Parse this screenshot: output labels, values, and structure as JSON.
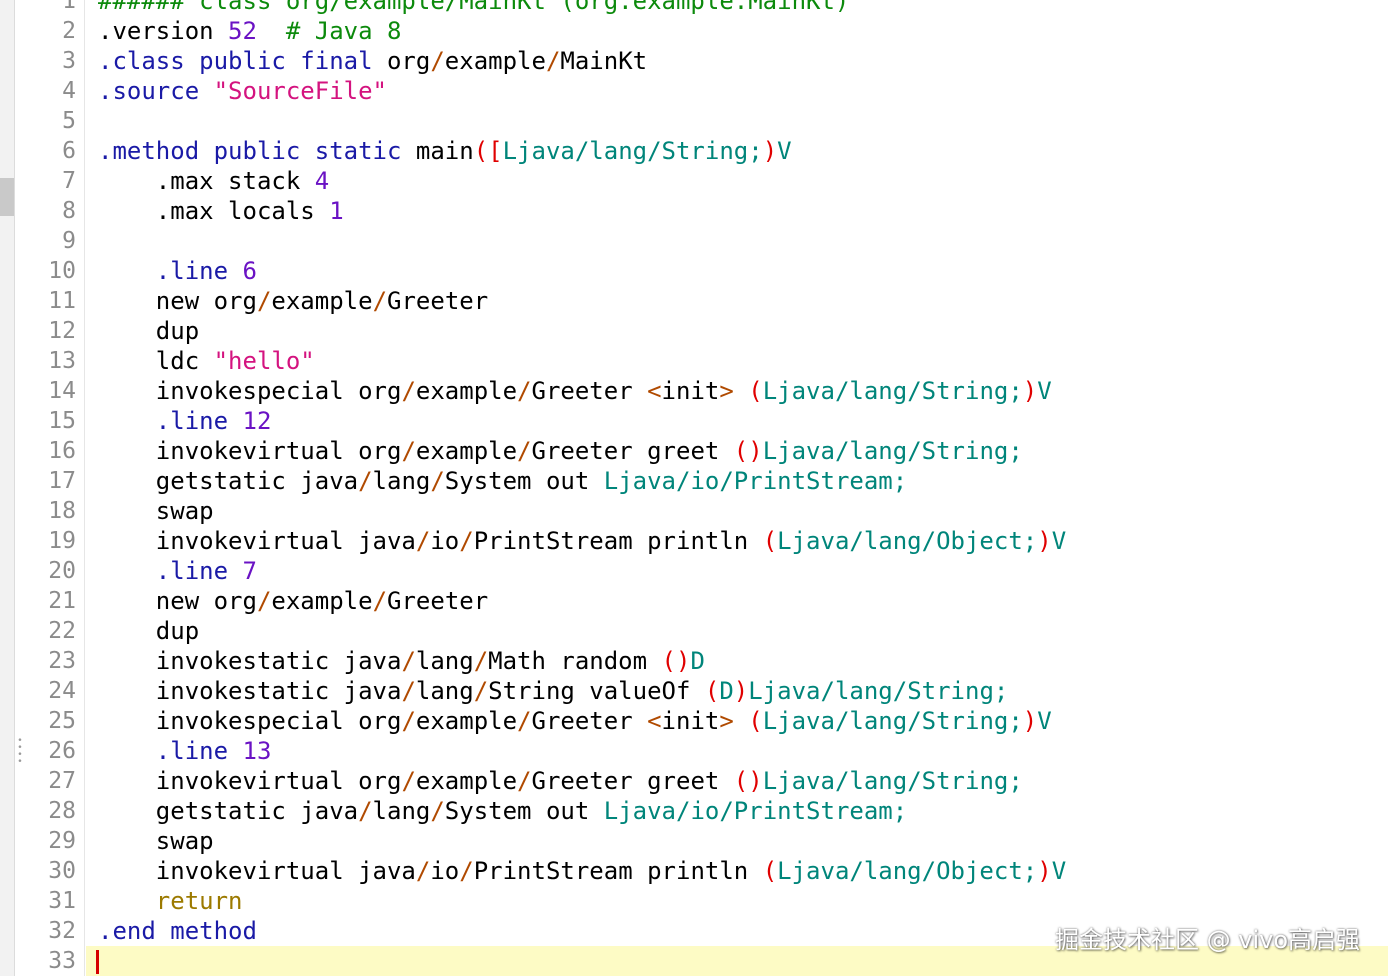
{
  "editor": {
    "current_line": 33,
    "lines": [
      {
        "n": "1",
        "tokens": [
          {
            "t": "###### class org/example/MainKt (org.example.MainKt)",
            "c": "comment"
          }
        ]
      },
      {
        "n": "2",
        "tokens": [
          {
            "t": ".version ",
            "c": "default"
          },
          {
            "t": "52",
            "c": "number"
          },
          {
            "t": "  ",
            "c": "default"
          },
          {
            "t": "# Java 8",
            "c": "comment"
          }
        ]
      },
      {
        "n": "3",
        "tokens": [
          {
            "t": ".class public final ",
            "c": "keyword"
          },
          {
            "t": "org",
            "c": "default"
          },
          {
            "t": "/",
            "c": "op"
          },
          {
            "t": "example",
            "c": "default"
          },
          {
            "t": "/",
            "c": "op"
          },
          {
            "t": "MainKt",
            "c": "default"
          }
        ]
      },
      {
        "n": "4",
        "tokens": [
          {
            "t": ".source ",
            "c": "keyword"
          },
          {
            "t": "\"SourceFile\"",
            "c": "string"
          }
        ]
      },
      {
        "n": "5",
        "tokens": []
      },
      {
        "n": "6",
        "tokens": [
          {
            "t": ".method public static ",
            "c": "keyword"
          },
          {
            "t": "main",
            "c": "default"
          },
          {
            "t": "([",
            "c": "punct"
          },
          {
            "t": "Ljava/lang/String;",
            "c": "type"
          },
          {
            "t": ")",
            "c": "punct"
          },
          {
            "t": "V",
            "c": "type"
          }
        ]
      },
      {
        "n": "7",
        "tokens": [
          {
            "t": "    .max stack ",
            "c": "default"
          },
          {
            "t": "4",
            "c": "number"
          }
        ]
      },
      {
        "n": "8",
        "tokens": [
          {
            "t": "    .max locals ",
            "c": "default"
          },
          {
            "t": "1",
            "c": "number"
          }
        ]
      },
      {
        "n": "9",
        "tokens": []
      },
      {
        "n": "10",
        "tokens": [
          {
            "t": "    ",
            "c": "default"
          },
          {
            "t": ".line ",
            "c": "keyword"
          },
          {
            "t": "6",
            "c": "number"
          }
        ]
      },
      {
        "n": "11",
        "tokens": [
          {
            "t": "    new org",
            "c": "default"
          },
          {
            "t": "/",
            "c": "op"
          },
          {
            "t": "example",
            "c": "default"
          },
          {
            "t": "/",
            "c": "op"
          },
          {
            "t": "Greeter",
            "c": "default"
          }
        ]
      },
      {
        "n": "12",
        "tokens": [
          {
            "t": "    dup",
            "c": "default"
          }
        ]
      },
      {
        "n": "13",
        "tokens": [
          {
            "t": "    ldc ",
            "c": "default"
          },
          {
            "t": "\"hello\"",
            "c": "string"
          }
        ]
      },
      {
        "n": "14",
        "tokens": [
          {
            "t": "    invokespecial org",
            "c": "default"
          },
          {
            "t": "/",
            "c": "op"
          },
          {
            "t": "example",
            "c": "default"
          },
          {
            "t": "/",
            "c": "op"
          },
          {
            "t": "Greeter ",
            "c": "default"
          },
          {
            "t": "<",
            "c": "op"
          },
          {
            "t": "init",
            "c": "default"
          },
          {
            "t": ">",
            "c": "op"
          },
          {
            "t": " ",
            "c": "default"
          },
          {
            "t": "(",
            "c": "punct"
          },
          {
            "t": "Ljava/lang/String;",
            "c": "type"
          },
          {
            "t": ")",
            "c": "punct"
          },
          {
            "t": "V",
            "c": "type"
          }
        ]
      },
      {
        "n": "15",
        "tokens": [
          {
            "t": "    ",
            "c": "default"
          },
          {
            "t": ".line ",
            "c": "keyword"
          },
          {
            "t": "12",
            "c": "number"
          }
        ]
      },
      {
        "n": "16",
        "tokens": [
          {
            "t": "    invokevirtual org",
            "c": "default"
          },
          {
            "t": "/",
            "c": "op"
          },
          {
            "t": "example",
            "c": "default"
          },
          {
            "t": "/",
            "c": "op"
          },
          {
            "t": "Greeter greet ",
            "c": "default"
          },
          {
            "t": "()",
            "c": "punct"
          },
          {
            "t": "Ljava/lang/String;",
            "c": "type"
          }
        ]
      },
      {
        "n": "17",
        "tokens": [
          {
            "t": "    getstatic java",
            "c": "default"
          },
          {
            "t": "/",
            "c": "op"
          },
          {
            "t": "lang",
            "c": "default"
          },
          {
            "t": "/",
            "c": "op"
          },
          {
            "t": "System out ",
            "c": "default"
          },
          {
            "t": "Ljava/io/PrintStream;",
            "c": "type"
          }
        ]
      },
      {
        "n": "18",
        "tokens": [
          {
            "t": "    swap",
            "c": "default"
          }
        ]
      },
      {
        "n": "19",
        "tokens": [
          {
            "t": "    invokevirtual java",
            "c": "default"
          },
          {
            "t": "/",
            "c": "op"
          },
          {
            "t": "io",
            "c": "default"
          },
          {
            "t": "/",
            "c": "op"
          },
          {
            "t": "PrintStream println ",
            "c": "default"
          },
          {
            "t": "(",
            "c": "punct"
          },
          {
            "t": "Ljava/lang/Object;",
            "c": "type"
          },
          {
            "t": ")",
            "c": "punct"
          },
          {
            "t": "V",
            "c": "type"
          }
        ]
      },
      {
        "n": "20",
        "tokens": [
          {
            "t": "    ",
            "c": "default"
          },
          {
            "t": ".line ",
            "c": "keyword"
          },
          {
            "t": "7",
            "c": "number"
          }
        ]
      },
      {
        "n": "21",
        "tokens": [
          {
            "t": "    new org",
            "c": "default"
          },
          {
            "t": "/",
            "c": "op"
          },
          {
            "t": "example",
            "c": "default"
          },
          {
            "t": "/",
            "c": "op"
          },
          {
            "t": "Greeter",
            "c": "default"
          }
        ]
      },
      {
        "n": "22",
        "tokens": [
          {
            "t": "    dup",
            "c": "default"
          }
        ]
      },
      {
        "n": "23",
        "tokens": [
          {
            "t": "    invokestatic java",
            "c": "default"
          },
          {
            "t": "/",
            "c": "op"
          },
          {
            "t": "lang",
            "c": "default"
          },
          {
            "t": "/",
            "c": "op"
          },
          {
            "t": "Math random ",
            "c": "default"
          },
          {
            "t": "()",
            "c": "punct"
          },
          {
            "t": "D",
            "c": "type"
          }
        ]
      },
      {
        "n": "24",
        "tokens": [
          {
            "t": "    invokestatic java",
            "c": "default"
          },
          {
            "t": "/",
            "c": "op"
          },
          {
            "t": "lang",
            "c": "default"
          },
          {
            "t": "/",
            "c": "op"
          },
          {
            "t": "String valueOf ",
            "c": "default"
          },
          {
            "t": "(",
            "c": "punct"
          },
          {
            "t": "D",
            "c": "type"
          },
          {
            "t": ")",
            "c": "punct"
          },
          {
            "t": "Ljava/lang/String;",
            "c": "type"
          }
        ]
      },
      {
        "n": "25",
        "tokens": [
          {
            "t": "    invokespecial org",
            "c": "default"
          },
          {
            "t": "/",
            "c": "op"
          },
          {
            "t": "example",
            "c": "default"
          },
          {
            "t": "/",
            "c": "op"
          },
          {
            "t": "Greeter ",
            "c": "default"
          },
          {
            "t": "<",
            "c": "op"
          },
          {
            "t": "init",
            "c": "default"
          },
          {
            "t": ">",
            "c": "op"
          },
          {
            "t": " ",
            "c": "default"
          },
          {
            "t": "(",
            "c": "punct"
          },
          {
            "t": "Ljava/lang/String;",
            "c": "type"
          },
          {
            "t": ")",
            "c": "punct"
          },
          {
            "t": "V",
            "c": "type"
          }
        ]
      },
      {
        "n": "26",
        "tokens": [
          {
            "t": "    ",
            "c": "default"
          },
          {
            "t": ".line ",
            "c": "keyword"
          },
          {
            "t": "13",
            "c": "number"
          }
        ]
      },
      {
        "n": "27",
        "tokens": [
          {
            "t": "    invokevirtual org",
            "c": "default"
          },
          {
            "t": "/",
            "c": "op"
          },
          {
            "t": "example",
            "c": "default"
          },
          {
            "t": "/",
            "c": "op"
          },
          {
            "t": "Greeter greet ",
            "c": "default"
          },
          {
            "t": "()",
            "c": "punct"
          },
          {
            "t": "Ljava/lang/String;",
            "c": "type"
          }
        ]
      },
      {
        "n": "28",
        "tokens": [
          {
            "t": "    getstatic java",
            "c": "default"
          },
          {
            "t": "/",
            "c": "op"
          },
          {
            "t": "lang",
            "c": "default"
          },
          {
            "t": "/",
            "c": "op"
          },
          {
            "t": "System out ",
            "c": "default"
          },
          {
            "t": "Ljava/io/PrintStream;",
            "c": "type"
          }
        ]
      },
      {
        "n": "29",
        "tokens": [
          {
            "t": "    swap",
            "c": "default"
          }
        ]
      },
      {
        "n": "30",
        "tokens": [
          {
            "t": "    invokevirtual java",
            "c": "default"
          },
          {
            "t": "/",
            "c": "op"
          },
          {
            "t": "io",
            "c": "default"
          },
          {
            "t": "/",
            "c": "op"
          },
          {
            "t": "PrintStream println ",
            "c": "default"
          },
          {
            "t": "(",
            "c": "punct"
          },
          {
            "t": "Ljava/lang/Object;",
            "c": "type"
          },
          {
            "t": ")",
            "c": "punct"
          },
          {
            "t": "V",
            "c": "type"
          }
        ]
      },
      {
        "n": "31",
        "tokens": [
          {
            "t": "    ",
            "c": "default"
          },
          {
            "t": "return",
            "c": "return"
          }
        ]
      },
      {
        "n": "32",
        "tokens": [
          {
            "t": ".end method",
            "c": "keyword"
          }
        ]
      },
      {
        "n": "33",
        "tokens": []
      }
    ]
  },
  "watermark": "掘金技术社区 @ vivo高启强"
}
